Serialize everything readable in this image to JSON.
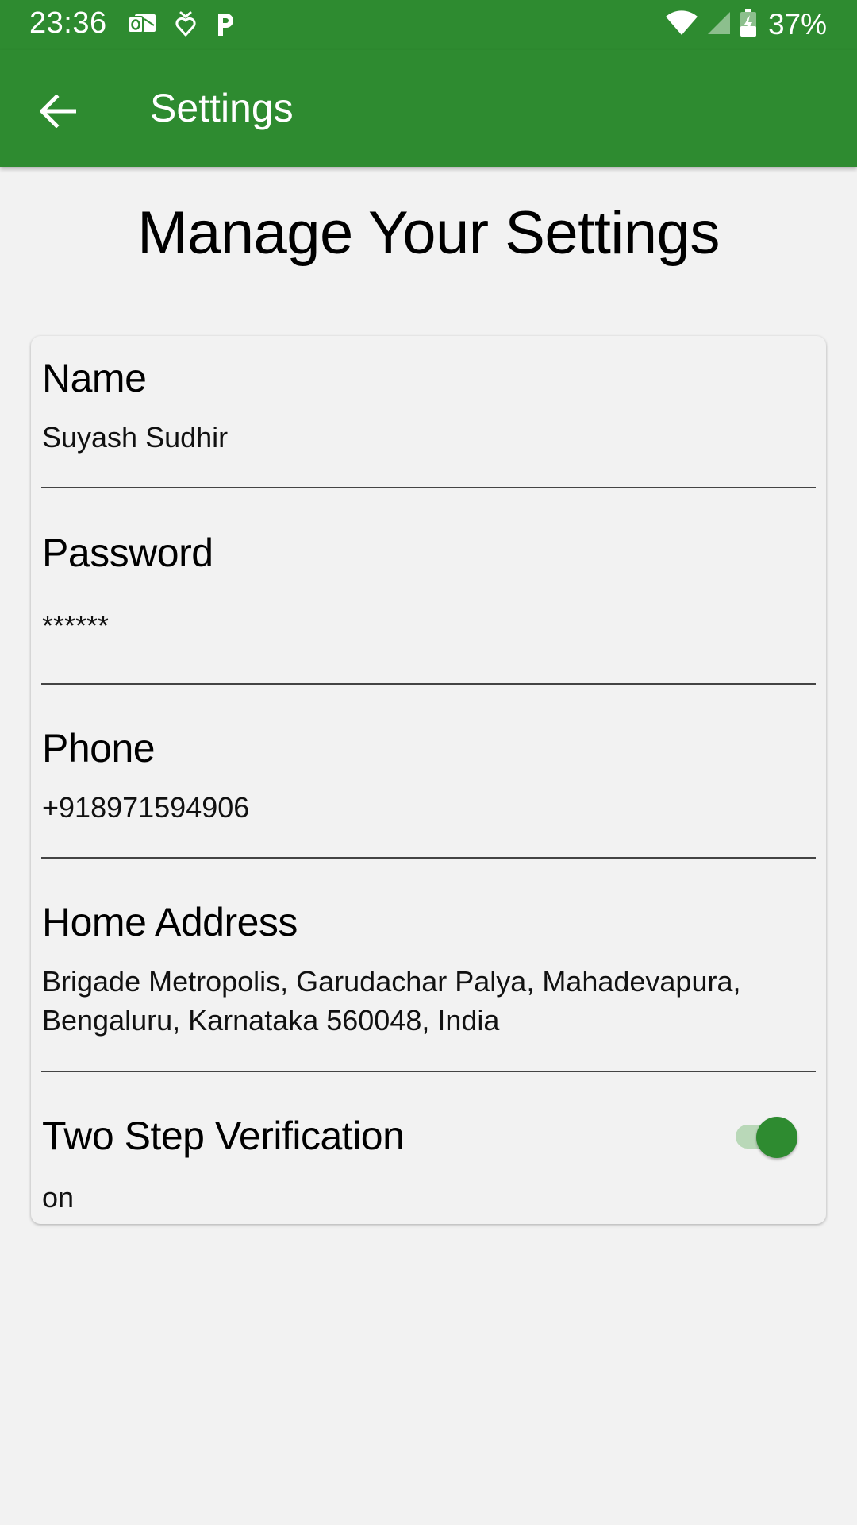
{
  "status_bar": {
    "time": "23:36",
    "battery": "37%",
    "icons_left": [
      "outlook-icon",
      "shield-heart-icon",
      "paytm-p-icon"
    ],
    "icons_right": [
      "wifi-icon",
      "cell-signal-icon",
      "battery-charging-icon"
    ]
  },
  "app_bar": {
    "title": "Settings",
    "color": "#2e8b30"
  },
  "page": {
    "heading": "Manage Your Settings"
  },
  "fields": {
    "name": {
      "label": "Name",
      "value": "Suyash Sudhir"
    },
    "password": {
      "label": "Password",
      "value": "******"
    },
    "phone": {
      "label": "Phone",
      "value": "+918971594906"
    },
    "address": {
      "label": "Home Address",
      "value": "Brigade Metropolis, Garudachar Palya, Mahadevapura, Bengaluru, Karnataka 560048, India"
    },
    "two_step": {
      "label": "Two Step Verification",
      "value": "on",
      "enabled": true
    }
  }
}
